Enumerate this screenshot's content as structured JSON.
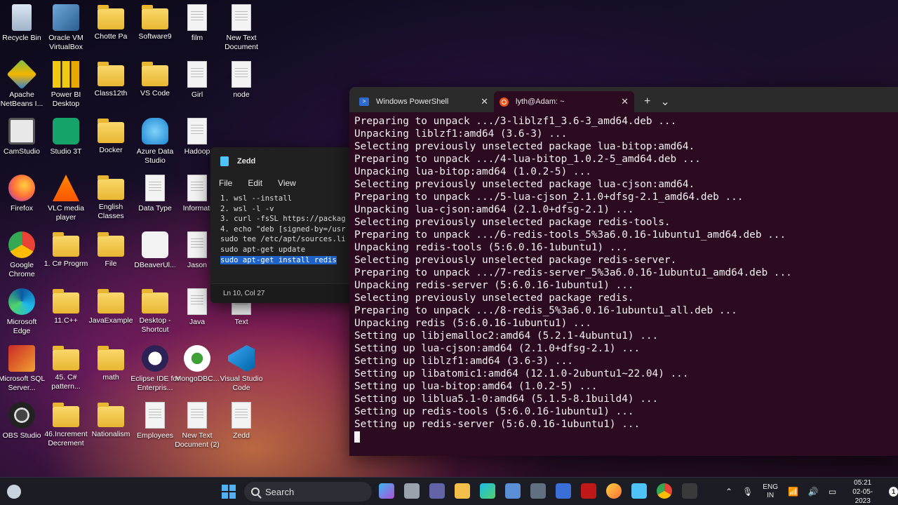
{
  "desktop": {
    "icons": [
      {
        "label": "Recycle Bin",
        "icon": "recycle-bin-icon"
      },
      {
        "label": "Oracle VM VirtualBox",
        "icon": "virtualbox-icon"
      },
      {
        "label": "Chotte Pa",
        "icon": "folder-icon"
      },
      {
        "label": "Software9",
        "icon": "folder-icon"
      },
      {
        "label": "film",
        "icon": "file-icon"
      },
      {
        "label": "New Text Document",
        "icon": "file-icon"
      },
      {
        "label": "Apache NetBeans I...",
        "icon": "netbeans-icon"
      },
      {
        "label": "Power BI Desktop",
        "icon": "powerbi-icon"
      },
      {
        "label": "Class12th",
        "icon": "folder-icon"
      },
      {
        "label": "VS Code",
        "icon": "folder-icon"
      },
      {
        "label": "Girl",
        "icon": "file-icon"
      },
      {
        "label": "node",
        "icon": "file-icon"
      },
      {
        "label": "CamStudio",
        "icon": "camstudio-icon"
      },
      {
        "label": "Studio 3T",
        "icon": "studio3t-icon"
      },
      {
        "label": "Docker",
        "icon": "folder-icon"
      },
      {
        "label": "Azure Data Studio",
        "icon": "azure-data-studio-icon"
      },
      {
        "label": "Hadoop",
        "icon": "file-icon"
      },
      {
        "label": "Firefox",
        "icon": "firefox-icon"
      },
      {
        "label": "VLC media player",
        "icon": "vlc-icon"
      },
      {
        "label": "English Classes",
        "icon": "folder-icon"
      },
      {
        "label": "Data Type",
        "icon": "file-icon"
      },
      {
        "label": "Informati",
        "icon": "file-icon"
      },
      {
        "label": "Google Chrome",
        "icon": "chrome-icon"
      },
      {
        "label": "1. C# Progrm",
        "icon": "folder-icon"
      },
      {
        "label": "File",
        "icon": "folder-icon"
      },
      {
        "label": "DBeaverUl...",
        "icon": "dbeaver-icon"
      },
      {
        "label": "Jason",
        "icon": "file-icon"
      },
      {
        "label": "Microsoft Edge",
        "icon": "edge-icon"
      },
      {
        "label": "11.C++",
        "icon": "folder-icon"
      },
      {
        "label": "JavaExample",
        "icon": "folder-icon"
      },
      {
        "label": "Desktop - Shortcut",
        "icon": "folder-icon"
      },
      {
        "label": "Java",
        "icon": "file-icon"
      },
      {
        "label": "Text",
        "icon": "file-icon"
      },
      {
        "label": "Microsoft SQL Server...",
        "icon": "sql-server-icon"
      },
      {
        "label": "45. C# pattern...",
        "icon": "folder-icon"
      },
      {
        "label": "math",
        "icon": "folder-icon"
      },
      {
        "label": "Eclipse IDE for Enterpris...",
        "icon": "eclipse-icon"
      },
      {
        "label": "MongoDBC...",
        "icon": "mongodb-icon"
      },
      {
        "label": "Visual Studio Code",
        "icon": "vscode-icon"
      },
      {
        "label": "OBS Studio",
        "icon": "obs-icon"
      },
      {
        "label": "46.Increment Decrement",
        "icon": "folder-icon"
      },
      {
        "label": "Nationalism",
        "icon": "folder-icon"
      },
      {
        "label": "Employees",
        "icon": "file-icon"
      },
      {
        "label": "New Text Document (2)",
        "icon": "file-icon"
      },
      {
        "label": "Zedd",
        "icon": "file-icon"
      }
    ]
  },
  "notepad": {
    "title": "Zedd",
    "menu": [
      "File",
      "Edit",
      "View"
    ],
    "lines": [
      "1. wsl --install",
      "2. wsl -l -v",
      "3. curl -fsSL https://packag",
      "",
      "4. echo \"deb [signed-by=/usr",
      "sudo tee /etc/apt/sources.li",
      "",
      "sudo apt-get update"
    ],
    "selected_line": "sudo apt-get install redis",
    "status": "Ln 10, Col 27"
  },
  "terminal": {
    "tabs": [
      {
        "label": "Windows PowerShell",
        "icon": "powershell-icon",
        "active": false
      },
      {
        "label": "lyth@Adam: ~",
        "icon": "ubuntu-icon",
        "active": true
      }
    ],
    "new_tab": "+",
    "dropdown": "⌄",
    "close": "✕",
    "lines": [
      "Preparing to unpack .../3-liblzf1_3.6-3_amd64.deb ...",
      "Unpacking liblzf1:amd64 (3.6-3) ...",
      "Selecting previously unselected package lua-bitop:amd64.",
      "Preparing to unpack .../4-lua-bitop_1.0.2-5_amd64.deb ...",
      "Unpacking lua-bitop:amd64 (1.0.2-5) ...",
      "Selecting previously unselected package lua-cjson:amd64.",
      "Preparing to unpack .../5-lua-cjson_2.1.0+dfsg-2.1_amd64.deb ...",
      "Unpacking lua-cjson:amd64 (2.1.0+dfsg-2.1) ...",
      "Selecting previously unselected package redis-tools.",
      "Preparing to unpack .../6-redis-tools_5%3a6.0.16-1ubuntu1_amd64.deb ...",
      "Unpacking redis-tools (5:6.0.16-1ubuntu1) ...",
      "Selecting previously unselected package redis-server.",
      "Preparing to unpack .../7-redis-server_5%3a6.0.16-1ubuntu1_amd64.deb ...",
      "Unpacking redis-server (5:6.0.16-1ubuntu1) ...",
      "Selecting previously unselected package redis.",
      "Preparing to unpack .../8-redis_5%3a6.0.16-1ubuntu1_all.deb ...",
      "Unpacking redis (5:6.0.16-1ubuntu1) ...",
      "Setting up libjemalloc2:amd64 (5.2.1-4ubuntu1) ...",
      "Setting up lua-cjson:amd64 (2.1.0+dfsg-2.1) ...",
      "Setting up liblzf1:amd64 (3.6-3) ...",
      "Setting up libatomic1:amd64 (12.1.0-2ubuntu1~22.04) ...",
      "Setting up lua-bitop:amd64 (1.0.2-5) ...",
      "Setting up liblua5.1-0:amd64 (5.1.5-8.1build4) ...",
      "Setting up redis-tools (5:6.0.16-1ubuntu1) ...",
      "Setting up redis-server (5:6.0.16-1ubuntu1) ..."
    ]
  },
  "taskbar": {
    "search_label": "Search",
    "apps": [
      "copilot-icon",
      "task-view-icon",
      "teams-icon",
      "file-explorer-icon",
      "edge-icon",
      "store-icon",
      "app-icon",
      "vscode-icon",
      "mcafee-icon",
      "firefox-icon",
      "notepad-icon",
      "chrome-icon",
      "terminal-icon"
    ],
    "lang_line1": "ENG",
    "lang_line2": "IN",
    "time": "05:21",
    "date": "02-05-2023",
    "notification_count": "1",
    "colors": {
      "accent": "#4fb2f5",
      "terminal_bg": "#2c0a20"
    }
  }
}
